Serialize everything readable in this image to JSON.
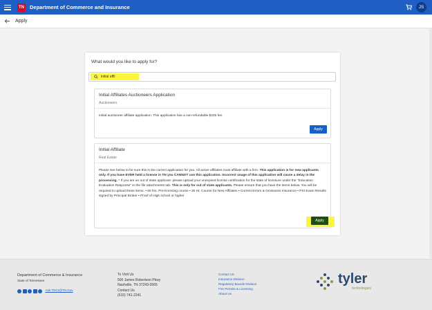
{
  "header": {
    "logo_text": "TN",
    "title": "Department of Commerce and Insurance",
    "avatar_initials": "JS"
  },
  "subheader": {
    "title": "Apply"
  },
  "card": {
    "question": "What would you like to apply for?",
    "search_value": "initial affil",
    "results": [
      {
        "title": "Initial Affiliates Auctioneers Application",
        "subtitle": "Auctioneers",
        "description": "Initial auctioneer affiliate application. This application has a non-refundable $225 fee.",
        "button_label": "Apply"
      },
      {
        "title": "Initial Affiliate",
        "subtitle": "Real Estate",
        "description_part1": "Please see below to be sure this is the correct application for you. All active affiliates must affiliate with a firm. ",
        "description_bold1": "This application is for new applicants only. If you have EVER held a license in TN you CANNOT use this application. Incorrect usage of this application will cause a delay in the processing.",
        "description_part2": " * If you are an out of state applicant- please upload your unexpired license certification for the state of licensure under the \"Education Evaluation Response\" in the file attachments tab. ",
        "description_bold2": "This is only for out of state applicants.",
        "description_part3": " Please ensure that you have the items below. You will be required to upload these items. • 60 hrs. Pre-licensing course • 30 Hr. Course for New Affiliates • Current Errors & Omissions Insurance • PSI Exam Results signed by Principal Broker • Proof of High school or higher",
        "button_label": "Apply"
      }
    ]
  },
  "footer": {
    "dept": "Department of Commerce & Insurance",
    "state": "State of Tennessee",
    "ask": "Ask TDCI@TN.Gov",
    "visit_title": "To Visit Us",
    "address1": "500 James Robertson Pkwy",
    "address2": "Nashville, TN 37243-0565",
    "contact_title": "Contact Us",
    "phone": "(615) 741-2241",
    "links": [
      "Contact Us",
      "Insurance Division",
      "Regulatory Boards Division",
      "Fire Permits & Licensing",
      "About Us"
    ],
    "brand": "tyler",
    "brand_sub": "technologies"
  },
  "colors": {
    "primary": "#1f5fc4",
    "highlight": "#fbf53d",
    "apply_dark": "#1f4e10"
  }
}
